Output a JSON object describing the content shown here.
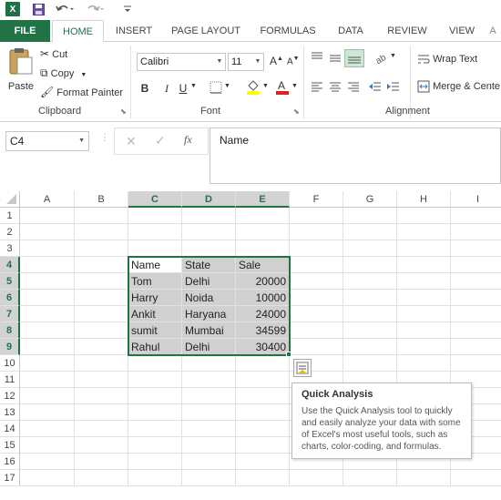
{
  "quick_access": {
    "save_icon": "save-icon",
    "undo_icon": "undo-icon",
    "redo_icon": "redo-icon"
  },
  "tabs": [
    "FILE",
    "HOME",
    "INSERT",
    "PAGE LAYOUT",
    "FORMULAS",
    "DATA",
    "REVIEW",
    "VIEW"
  ],
  "ribbon": {
    "clipboard": {
      "label": "Clipboard",
      "paste": "Paste",
      "cut": "Cut",
      "copy": "Copy",
      "format_painter": "Format Painter"
    },
    "font": {
      "label": "Font",
      "name": "Calibri",
      "size": "11",
      "bold": "B",
      "italic": "I",
      "underline": "U"
    },
    "alignment": {
      "label": "Alignment",
      "wrap_text": "Wrap Text",
      "merge_center": "Merge & Cente"
    }
  },
  "formula_bar": {
    "name_box": "C4",
    "content": "Name",
    "fx": "fx"
  },
  "columns": [
    "A",
    "B",
    "C",
    "D",
    "E",
    "F",
    "G",
    "H",
    "I"
  ],
  "rows": [
    "1",
    "2",
    "3",
    "4",
    "5",
    "6",
    "7",
    "8",
    "9",
    "10",
    "11",
    "12",
    "13",
    "14",
    "15",
    "16",
    "17"
  ],
  "table": {
    "headers": [
      "Name",
      "State",
      "Sale"
    ],
    "rows": [
      [
        "Tom",
        "Delhi",
        "20000"
      ],
      [
        "Harry",
        "Noida",
        "10000"
      ],
      [
        "Ankit",
        "Haryana",
        "24000"
      ],
      [
        "sumit",
        "Mumbai",
        "34599"
      ],
      [
        "Rahul",
        "Delhi",
        "30400"
      ]
    ]
  },
  "tooltip": {
    "title": "Quick Analysis",
    "body": "Use the Quick Analysis tool to quickly and easily analyze your data with some of Excel's most useful tools, such as charts, color-coding, and formulas."
  },
  "colors": {
    "accent": "#217346",
    "selection_shade": "#d0d0d0"
  }
}
